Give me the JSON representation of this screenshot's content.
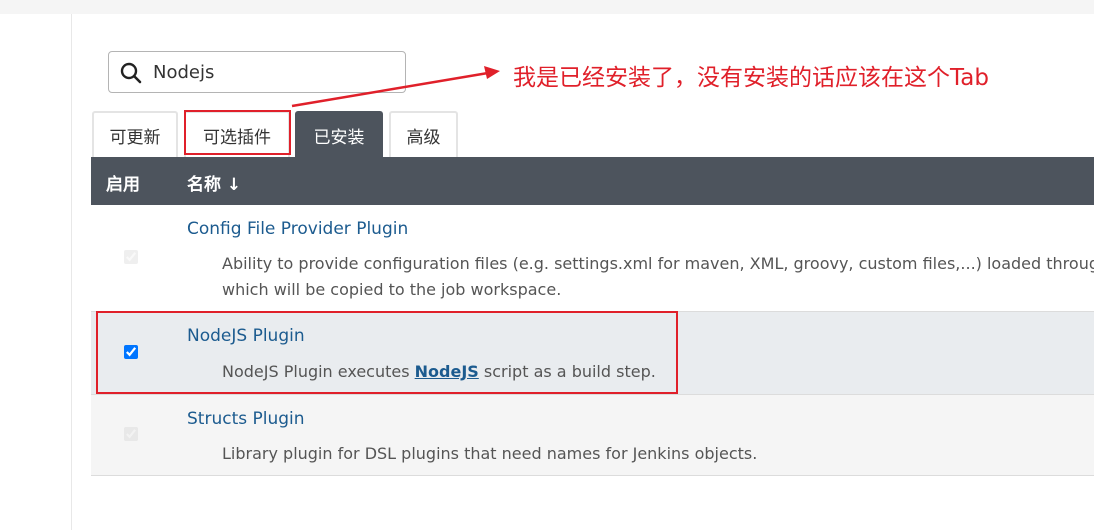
{
  "search": {
    "value": "Nodejs"
  },
  "annotation": {
    "text": "我是已经安装了，没有安装的话应该在这个Tab",
    "color": "#e0202a"
  },
  "tabs": [
    {
      "label": "可更新"
    },
    {
      "label": "可选插件"
    },
    {
      "label": "已安装"
    },
    {
      "label": "高级"
    }
  ],
  "table": {
    "headers": {
      "enabled": "启用",
      "name": "名称 ↓"
    },
    "rows": [
      {
        "name": "Config File Provider Plugin",
        "description_line1": "Ability to provide configuration files (e.g. settings.xml for maven, XML, groovy, custom files,...) loaded through the",
        "description_line2": "which will be copied to the job workspace.",
        "enabled": true
      },
      {
        "name": "NodeJS Plugin",
        "description_pre": "NodeJS Plugin executes ",
        "description_link": "NodeJS",
        "description_post": " script as a build step.",
        "enabled": true
      },
      {
        "name": "Structs Plugin",
        "description_line1": "Library plugin for DSL plugins that need names for Jenkins objects.",
        "enabled": true
      }
    ]
  },
  "colors": {
    "header_bg": "#4d545d",
    "link": "#1c5b8f",
    "highlight": "#e0202a"
  }
}
